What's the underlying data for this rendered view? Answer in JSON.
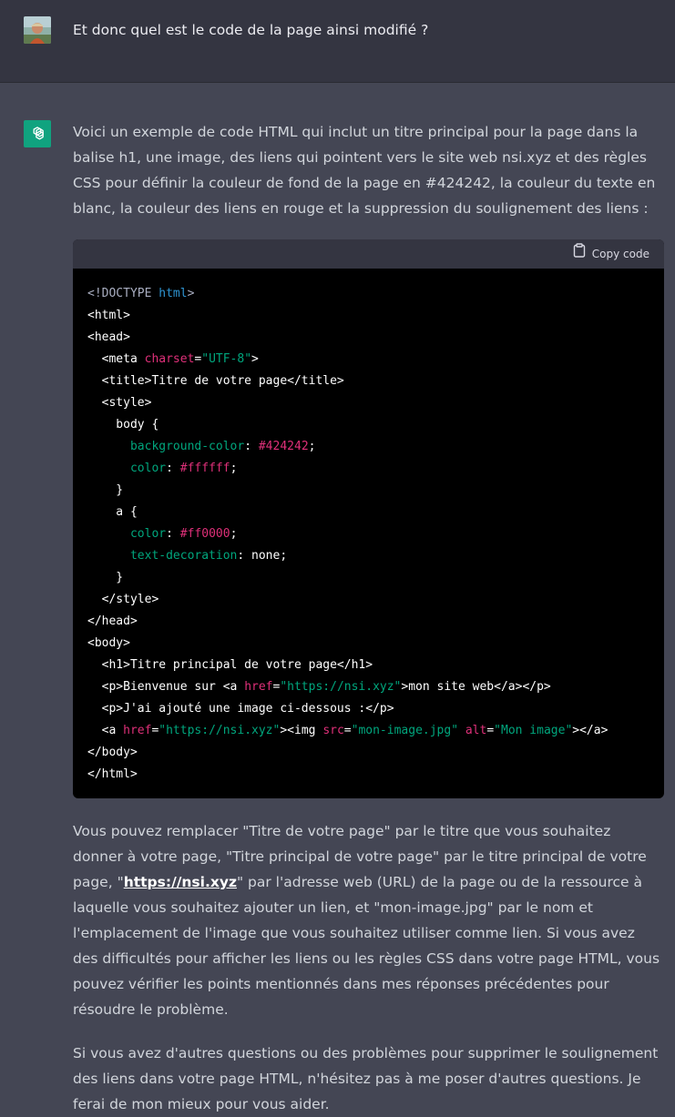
{
  "user": {
    "message": "Et donc quel est le code de la page ainsi modifié ?"
  },
  "assistant": {
    "intro": "Voici un exemple de code HTML qui inclut un titre principal pour la page dans la balise h1, une image, des liens qui pointent vers le site web nsi.xyz et des règles CSS pour définir la couleur de fond de la page en #424242, la couleur du texte en blanc, la couleur des liens en rouge et la suppression du soulignement des liens :",
    "copy_label": "Copy code",
    "p1_before": "Vous pouvez remplacer \"Titre de votre page\" par le titre que vous souhaitez donner à votre page, \"Titre principal de votre page\" par le titre principal de votre page, \"",
    "p1_link": "https://nsi.xyz",
    "p1_after": "\" par l'adresse web (URL) de la page ou de la ressource à laquelle vous souhaitez ajouter un lien, et \"mon-image.jpg\" par le nom et l'emplacement de l'image que vous souhaitez utiliser comme lien. Si vous avez des difficultés pour afficher les liens ou les règles CSS dans votre page HTML, vous pouvez vérifier les points mentionnés dans mes réponses précédentes pour résoudre le problème.",
    "p2": "Si vous avez d'autres questions ou des problèmes pour supprimer le soulignement des liens dans votre page HTML, n'hésitez pas à me poser d'autres questions. Je ferai de mon mieux pour vous aider."
  },
  "code": {
    "lines": [
      [
        [
          "dc",
          "<!DOCTYPE "
        ],
        [
          "kw",
          "html"
        ],
        [
          "dc",
          ">"
        ]
      ],
      [
        [
          "t",
          "<html>"
        ]
      ],
      [
        [
          "t",
          "<head>"
        ]
      ],
      [
        [
          "t",
          "  <meta "
        ],
        [
          "at",
          "charset"
        ],
        [
          "t",
          "="
        ],
        [
          "st",
          "\"UTF-8\""
        ],
        [
          "t",
          ">"
        ]
      ],
      [
        [
          "t",
          "  <title>Titre de votre page</title>"
        ]
      ],
      [
        [
          "t",
          "  <style>"
        ]
      ],
      [
        [
          "t",
          "    body {"
        ]
      ],
      [
        [
          "t",
          "      "
        ],
        [
          "pr",
          "background-color"
        ],
        [
          "t",
          ": "
        ],
        [
          "hx",
          "#424242"
        ],
        [
          "t",
          ";"
        ]
      ],
      [
        [
          "t",
          "      "
        ],
        [
          "pr",
          "color"
        ],
        [
          "t",
          ": "
        ],
        [
          "hx",
          "#ffffff"
        ],
        [
          "t",
          ";"
        ]
      ],
      [
        [
          "t",
          "    }"
        ]
      ],
      [
        [
          "t",
          "    a {"
        ]
      ],
      [
        [
          "t",
          "      "
        ],
        [
          "pr",
          "color"
        ],
        [
          "t",
          ": "
        ],
        [
          "hx",
          "#ff0000"
        ],
        [
          "t",
          ";"
        ]
      ],
      [
        [
          "t",
          "      "
        ],
        [
          "pr",
          "text-decoration"
        ],
        [
          "t",
          ": none;"
        ]
      ],
      [
        [
          "t",
          "    }"
        ]
      ],
      [
        [
          "t",
          "  </style>"
        ]
      ],
      [
        [
          "t",
          "</head>"
        ]
      ],
      [
        [
          "t",
          "<body>"
        ]
      ],
      [
        [
          "t",
          "  <h1>Titre principal de votre page</h1>"
        ]
      ],
      [
        [
          "t",
          "  <p>Bienvenue sur <a "
        ],
        [
          "at",
          "href"
        ],
        [
          "t",
          "="
        ],
        [
          "st",
          "\"https://nsi.xyz\""
        ],
        [
          "t",
          ">mon site web</a></p>"
        ]
      ],
      [
        [
          "t",
          "  <p>J'ai ajouté une image ci-dessous :</p>"
        ]
      ],
      [
        [
          "t",
          "  <a "
        ],
        [
          "at",
          "href"
        ],
        [
          "t",
          "="
        ],
        [
          "st",
          "\"https://nsi.xyz\""
        ],
        [
          "t",
          "><img "
        ],
        [
          "at",
          "src"
        ],
        [
          "t",
          "="
        ],
        [
          "st",
          "\"mon-image.jpg\""
        ],
        [
          "t",
          " "
        ],
        [
          "at",
          "alt"
        ],
        [
          "t",
          "="
        ],
        [
          "st",
          "\"Mon image\""
        ],
        [
          "t",
          "></a>"
        ]
      ],
      [
        [
          "t",
          "</body>"
        ]
      ],
      [
        [
          "t",
          "</html>"
        ]
      ]
    ]
  },
  "icons": {
    "user_avatar": "user-photo-avatar",
    "bot_avatar": "openai-logo-icon",
    "copy": "clipboard-icon"
  },
  "colors": {
    "user_bg": "#343541",
    "assistant_bg": "#444654",
    "bot_green": "#10a37f",
    "code_bg": "#000000"
  }
}
